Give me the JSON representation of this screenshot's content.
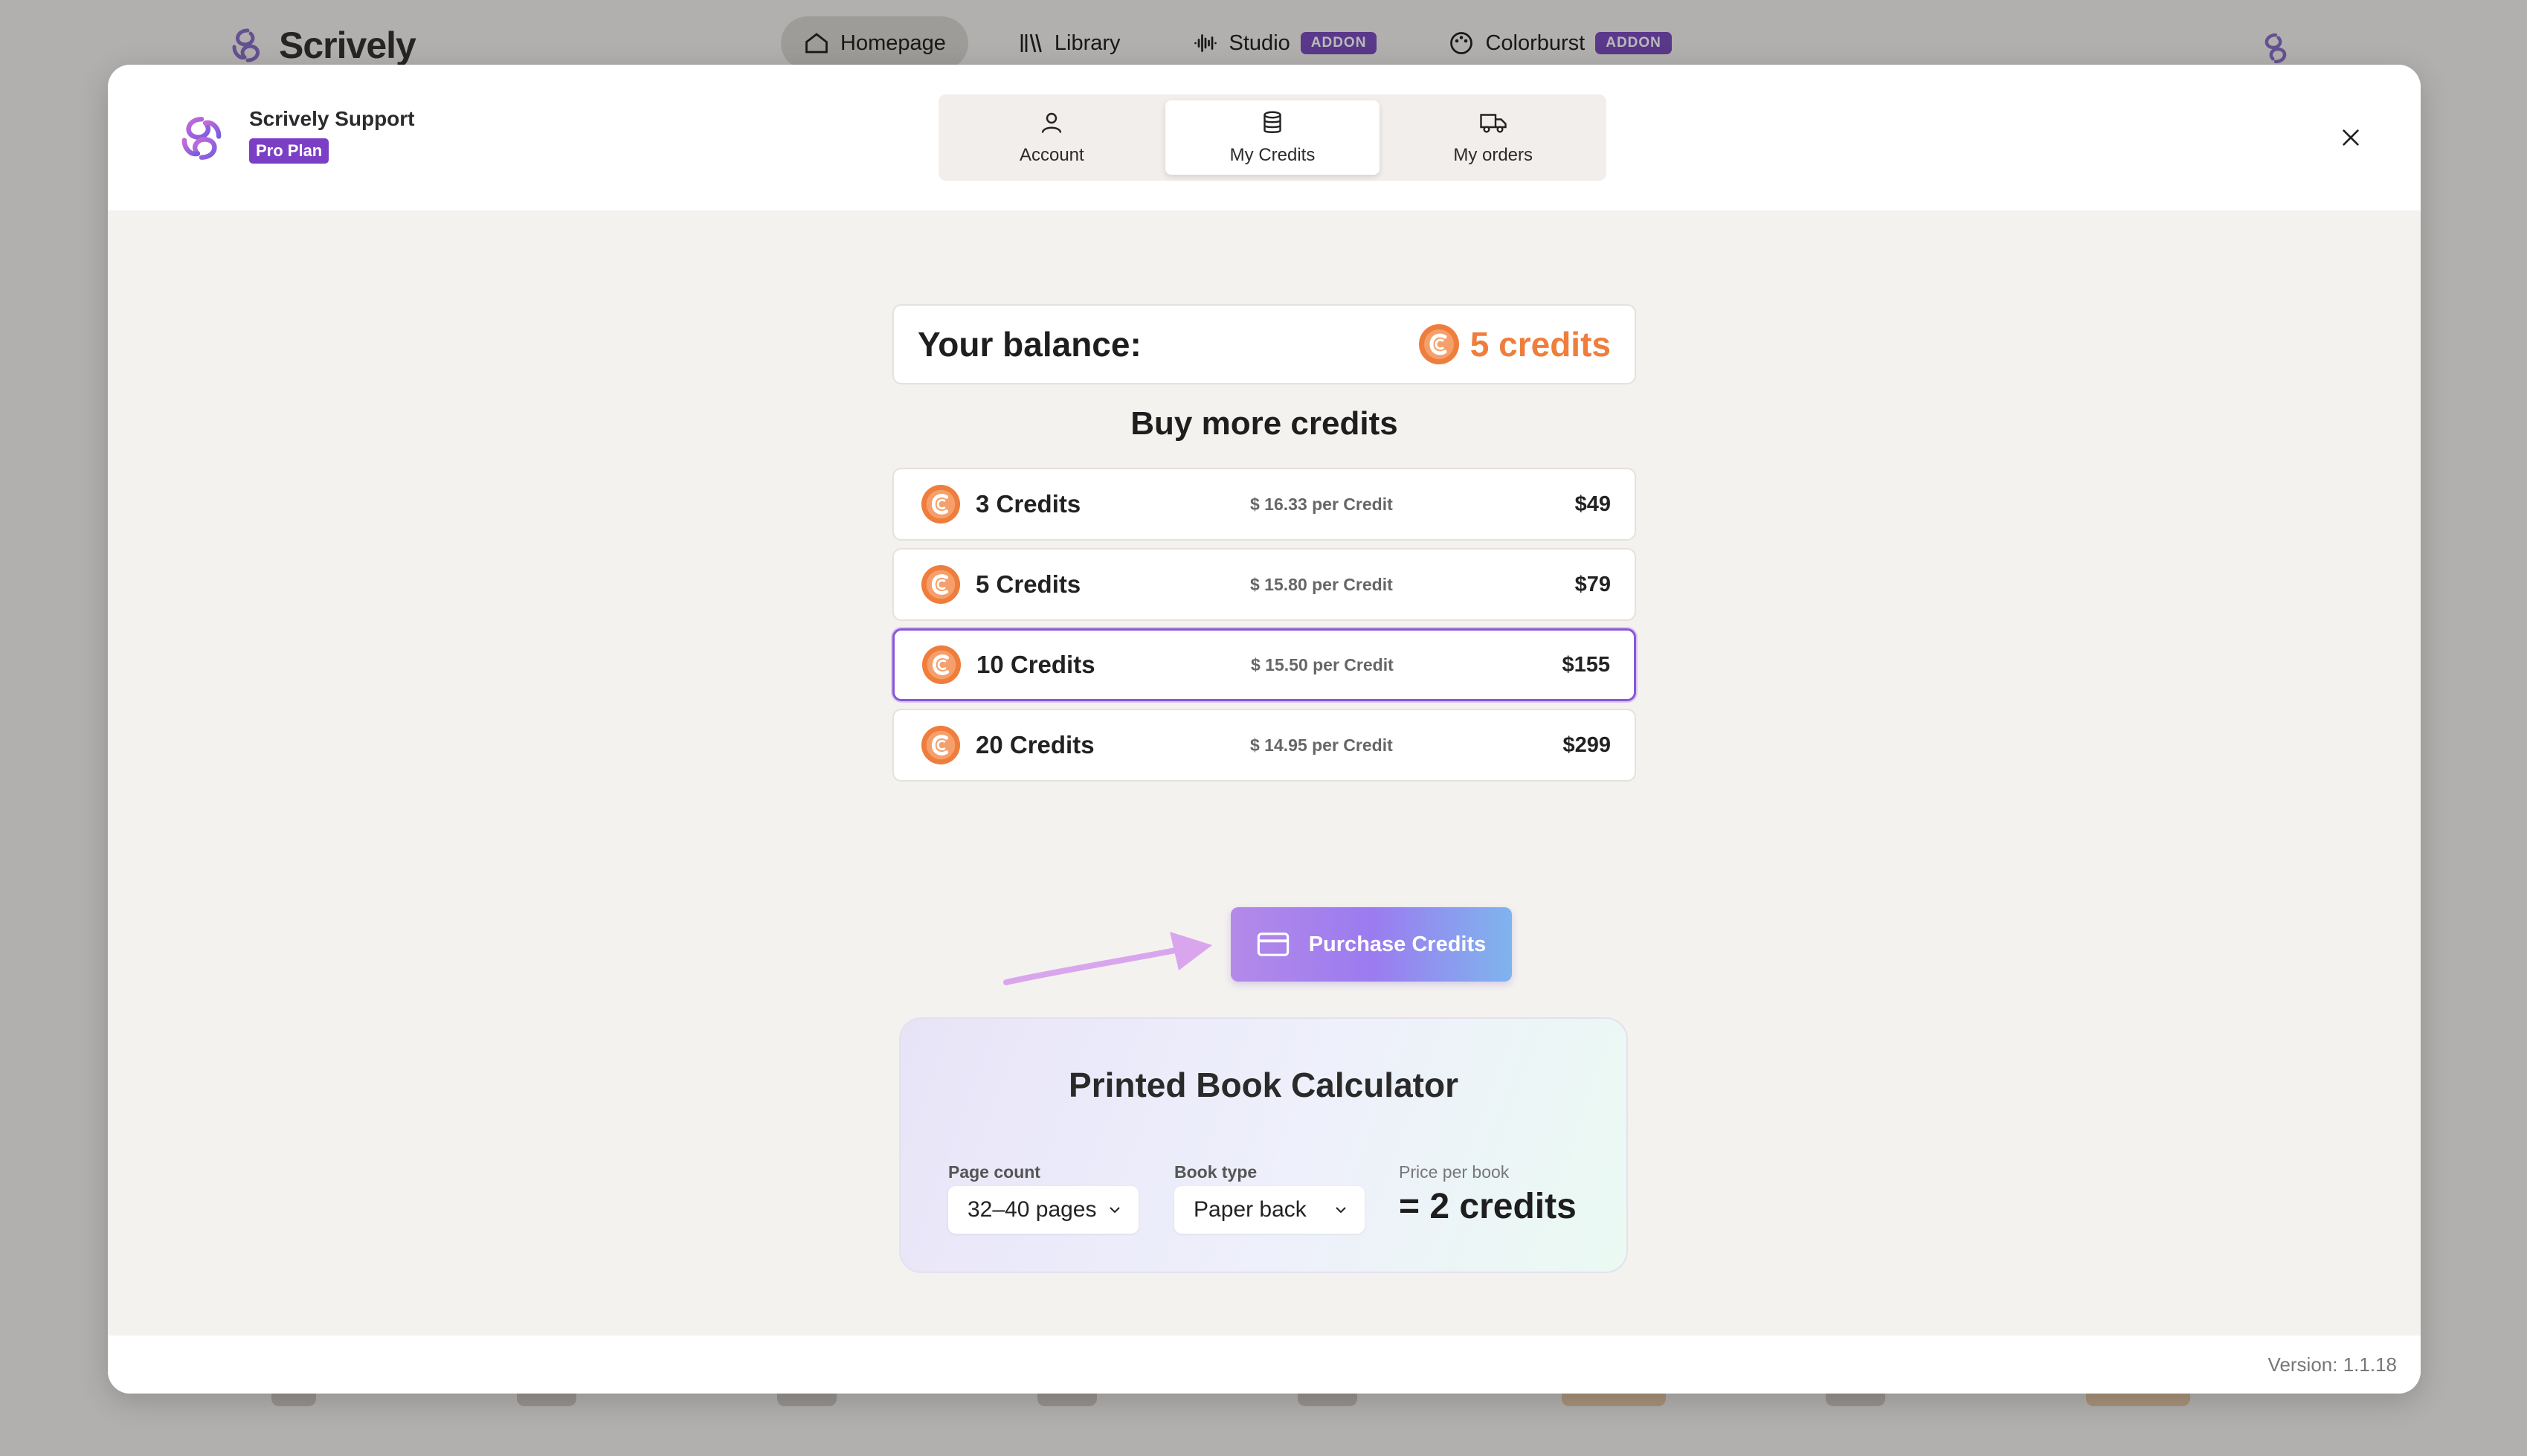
{
  "background_app": {
    "logo_text": "Scrively",
    "nav": [
      {
        "label": "Homepage",
        "icon": "home-icon",
        "active": true
      },
      {
        "label": "Library",
        "icon": "library-icon",
        "badge": ""
      },
      {
        "label": "Studio",
        "icon": "audio-wave-icon",
        "badge": "ADDON"
      },
      {
        "label": "Colorburst",
        "icon": "palette-icon",
        "badge": "ADDON"
      }
    ]
  },
  "modal": {
    "user": {
      "name": "Scrively Support",
      "plan": "Pro Plan"
    },
    "tabs": [
      {
        "label": "Account",
        "icon": "user-icon",
        "active": false
      },
      {
        "label": "My Credits",
        "icon": "coins-icon",
        "active": true
      },
      {
        "label": "My orders",
        "icon": "truck-icon",
        "active": false
      }
    ],
    "balance": {
      "label": "Your balance:",
      "value": "5 credits"
    },
    "buy_title": "Buy more credits",
    "packs": [
      {
        "label": "3 Credits",
        "per_credit": "$ 16.33 per Credit",
        "price": "$49",
        "selected": false
      },
      {
        "label": "5 Credits",
        "per_credit": "$ 15.80 per Credit",
        "price": "$79",
        "selected": false
      },
      {
        "label": "10 Credits",
        "per_credit": "$ 15.50 per Credit",
        "price": "$155",
        "selected": true
      },
      {
        "label": "20 Credits",
        "per_credit": "$ 14.95 per Credit",
        "price": "$299",
        "selected": false
      }
    ],
    "purchase_button": "Purchase Credits",
    "calculator": {
      "title": "Printed Book Calculator",
      "page_count_label": "Page count",
      "page_count_value": "32–40 pages",
      "book_type_label": "Book type",
      "book_type_value": "Paper back",
      "price_label": "Price per book",
      "price_value": "= 2 credits"
    },
    "version": "Version: 1.1.18"
  },
  "colors": {
    "accent_purple": "#7a3fc4",
    "credit_orange": "#ef7d3c",
    "selected_border": "#8a56d6"
  }
}
